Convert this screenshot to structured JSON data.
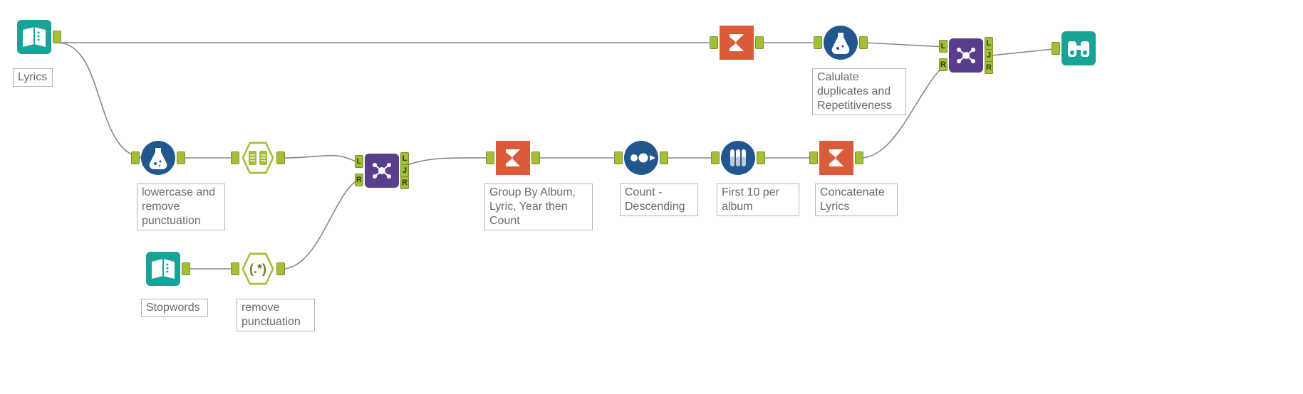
{
  "nodes": {
    "lyrics": {
      "label": "Lyrics"
    },
    "stopwords": {
      "label": "Stopwords"
    },
    "lowercase": {
      "label": "lowercase and\nremove\npunctuation"
    },
    "remove_punct": {
      "label": "remove\npunctuation"
    },
    "text_to_cols": {
      "label": ""
    },
    "join1": {
      "ports": [
        "L",
        "J",
        "R"
      ]
    },
    "groupby": {
      "label": "Group By Album,\nLyric, Year then\nCount"
    },
    "sort": {
      "label": "Count -\nDescending"
    },
    "sample": {
      "label": "First 10 per\nalbum"
    },
    "concat": {
      "label": "Concatenate\nLyrics"
    },
    "sum_top": {
      "label": ""
    },
    "calc_dup": {
      "label": "Calulate\nduplicates and\nRepetitiveness"
    },
    "join2": {
      "ports": [
        "L",
        "J",
        "R"
      ]
    },
    "browse": {
      "label": ""
    }
  },
  "colors": {
    "teal": "#17a398",
    "navy": "#22568f",
    "orange": "#d95b3a",
    "purple": "#5a3e8e",
    "olive": "#a2c037"
  }
}
